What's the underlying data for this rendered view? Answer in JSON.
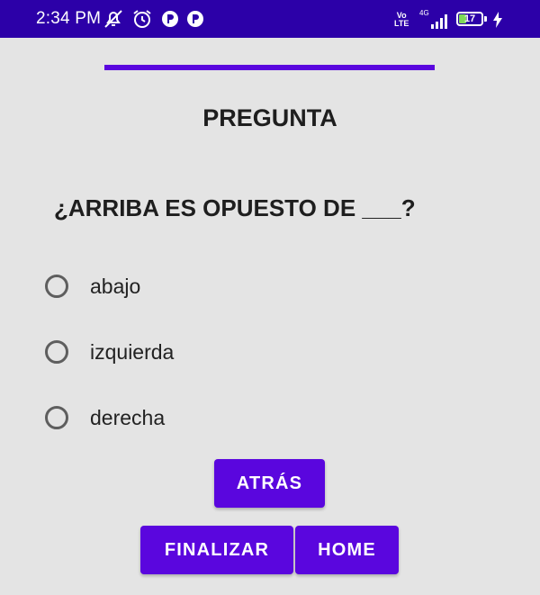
{
  "status_bar": {
    "time": "2:34 PM",
    "volte_top": "Vo",
    "volte_bottom": "LTE",
    "network": "4G",
    "battery_level": "17",
    "background_color": "#2c00a8",
    "icons": [
      "mute-icon",
      "alarm-icon",
      "app-notification-icon",
      "app-notification-icon",
      "signal-icon",
      "battery-icon",
      "charging-icon"
    ]
  },
  "quiz": {
    "progress_fraction": 1.0,
    "title": "PREGUNTA",
    "question": "¿ARRIBA ES OPUESTO DE ___?",
    "options": [
      {
        "label": "abajo"
      },
      {
        "label": "izquierda"
      },
      {
        "label": "derecha"
      }
    ]
  },
  "buttons": {
    "back": "ATRÁS",
    "finish": "FINALIZAR",
    "home": "HOME"
  },
  "colors": {
    "accent": "#5a06de",
    "background": "#e4e4e4"
  }
}
